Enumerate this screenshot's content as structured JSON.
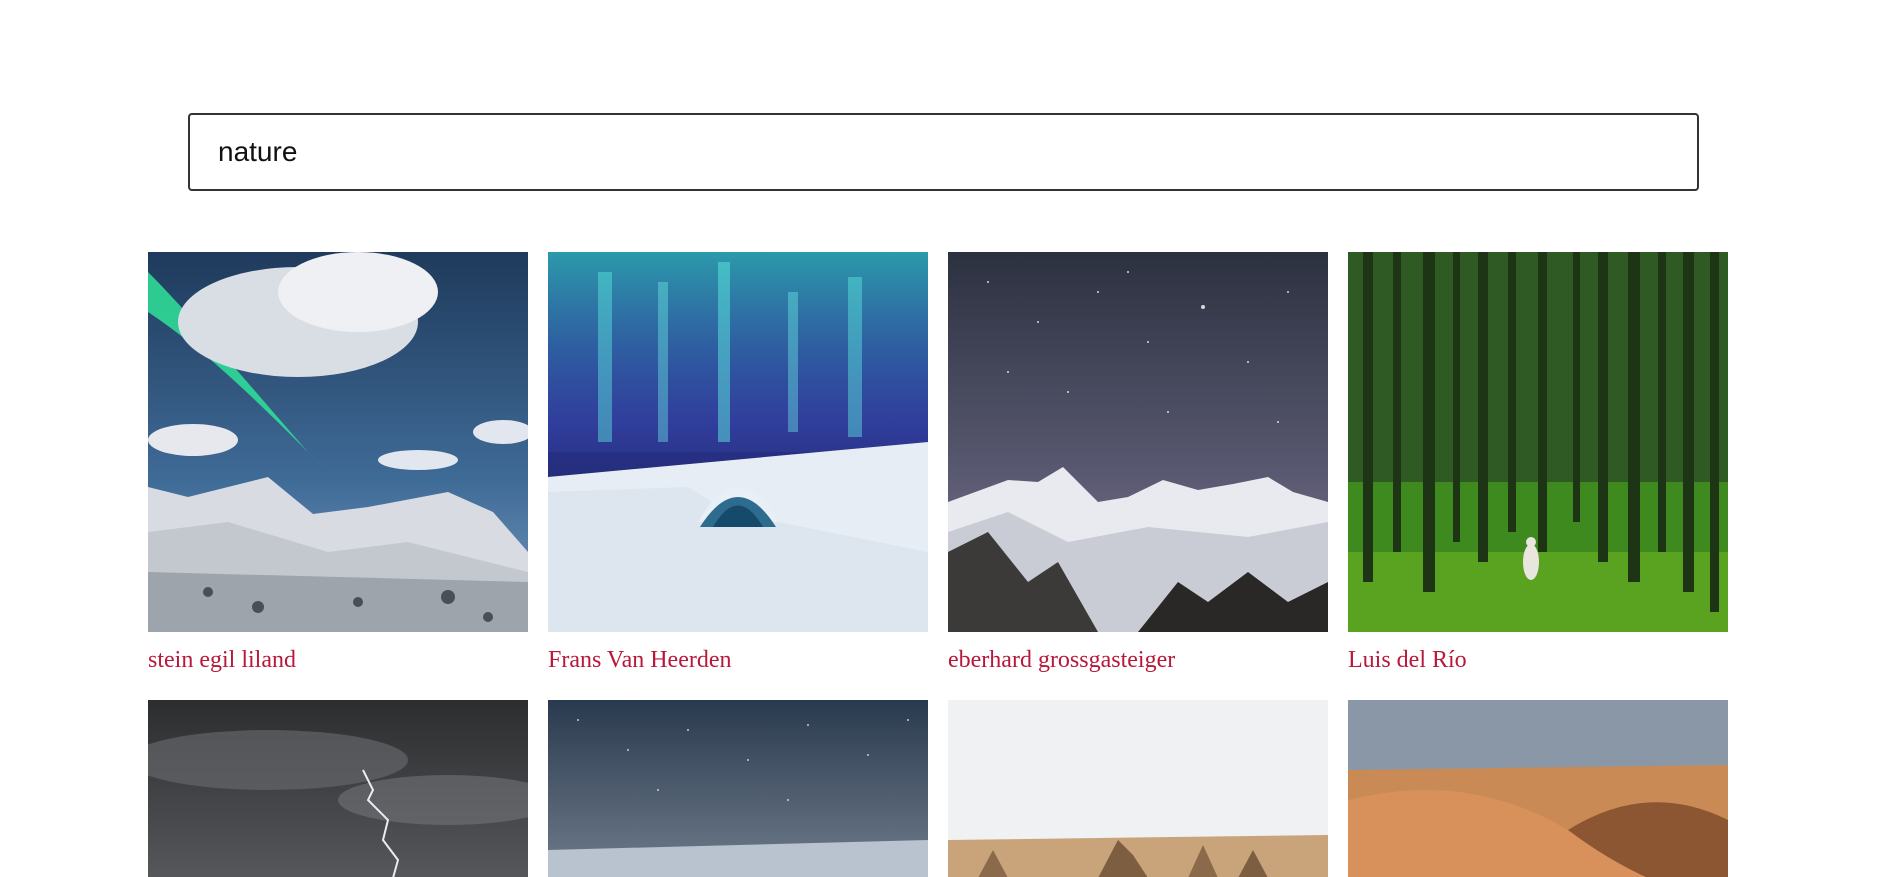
{
  "search": {
    "value": "nature",
    "placeholder": ""
  },
  "photos": [
    {
      "author": "stein egil liland",
      "subject": "aurora over snowy mountains"
    },
    {
      "author": "Frans Van Heerden",
      "subject": "aurora over ice hotel"
    },
    {
      "author": "eberhard grossgasteiger",
      "subject": "starry sky over snow peaks"
    },
    {
      "author": "Luis del Río",
      "subject": "person in green forest"
    },
    {
      "author": "",
      "subject": "lightning storm"
    },
    {
      "author": "",
      "subject": "starry night over snow"
    },
    {
      "author": "",
      "subject": "desert rock pinnacles"
    },
    {
      "author": "",
      "subject": "sand dunes"
    }
  ],
  "colors": {
    "caption": "#b8183a",
    "border": "#333333"
  }
}
